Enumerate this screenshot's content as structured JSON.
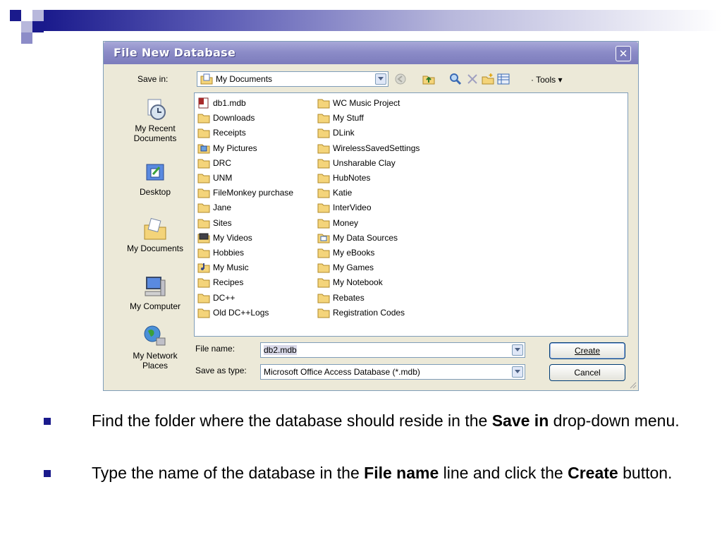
{
  "dialog": {
    "title": "File New Database",
    "save_in_label": "Save in:",
    "save_in_value": "My Documents",
    "tools_label": "Tools",
    "file_name_label": "File name:",
    "file_name_value": "db2.mdb",
    "save_type_label": "Save as type:",
    "save_type_value": "Microsoft Office Access Database (*.mdb)",
    "create_label": "Create",
    "cancel_label": "Cancel"
  },
  "places": [
    {
      "label": "My Recent Documents",
      "icon": "recent-documents-icon"
    },
    {
      "label": "Desktop",
      "icon": "desktop-icon"
    },
    {
      "label": "My Documents",
      "icon": "my-documents-icon"
    },
    {
      "label": "My Computer",
      "icon": "my-computer-icon"
    },
    {
      "label": "My Network Places",
      "icon": "network-places-icon"
    }
  ],
  "files_col1": [
    {
      "name": "db1.mdb",
      "icon": "access-db-icon"
    },
    {
      "name": "Downloads",
      "icon": "folder-icon"
    },
    {
      "name": "Receipts",
      "icon": "folder-icon"
    },
    {
      "name": "My Pictures",
      "icon": "pictures-folder-icon"
    },
    {
      "name": "DRC",
      "icon": "folder-icon"
    },
    {
      "name": "UNM",
      "icon": "folder-icon"
    },
    {
      "name": "FileMonkey purchase",
      "icon": "folder-icon"
    },
    {
      "name": "Jane",
      "icon": "folder-icon"
    },
    {
      "name": "Sites",
      "icon": "folder-icon"
    },
    {
      "name": "My Videos",
      "icon": "videos-folder-icon"
    },
    {
      "name": "Hobbies",
      "icon": "folder-icon"
    },
    {
      "name": "My Music",
      "icon": "music-folder-icon"
    },
    {
      "name": "Recipes",
      "icon": "folder-icon"
    },
    {
      "name": "DC++",
      "icon": "folder-icon"
    },
    {
      "name": "Old DC++Logs",
      "icon": "folder-icon"
    }
  ],
  "files_col2": [
    {
      "name": "WC Music Project",
      "icon": "folder-icon"
    },
    {
      "name": "My Stuff",
      "icon": "folder-icon"
    },
    {
      "name": "DLink",
      "icon": "folder-icon"
    },
    {
      "name": "WirelessSavedSettings",
      "icon": "folder-icon"
    },
    {
      "name": "Unsharable Clay",
      "icon": "folder-icon"
    },
    {
      "name": "HubNotes",
      "icon": "folder-icon"
    },
    {
      "name": "Katie",
      "icon": "folder-icon"
    },
    {
      "name": "InterVideo",
      "icon": "folder-icon"
    },
    {
      "name": "Money",
      "icon": "folder-icon"
    },
    {
      "name": "My Data Sources",
      "icon": "data-sources-folder-icon"
    },
    {
      "name": "My eBooks",
      "icon": "folder-icon"
    },
    {
      "name": "My Games",
      "icon": "folder-icon"
    },
    {
      "name": "My Notebook",
      "icon": "folder-icon"
    },
    {
      "name": "Rebates",
      "icon": "folder-icon"
    },
    {
      "name": "Registration Codes",
      "icon": "folder-icon"
    }
  ],
  "bullets": [
    {
      "before": "Find the folder where the database should reside in the ",
      "bold": "Save in",
      "after": " drop-down menu."
    },
    {
      "before": "Type the name of the database in the ",
      "bold": "File name",
      "after": " line and click the ",
      "bold2": "Create",
      "after2": " button."
    }
  ],
  "colors": {
    "accent": "#1a1a8c",
    "folder": "#f4d47a",
    "dialog_bg": "#ece9d8"
  }
}
